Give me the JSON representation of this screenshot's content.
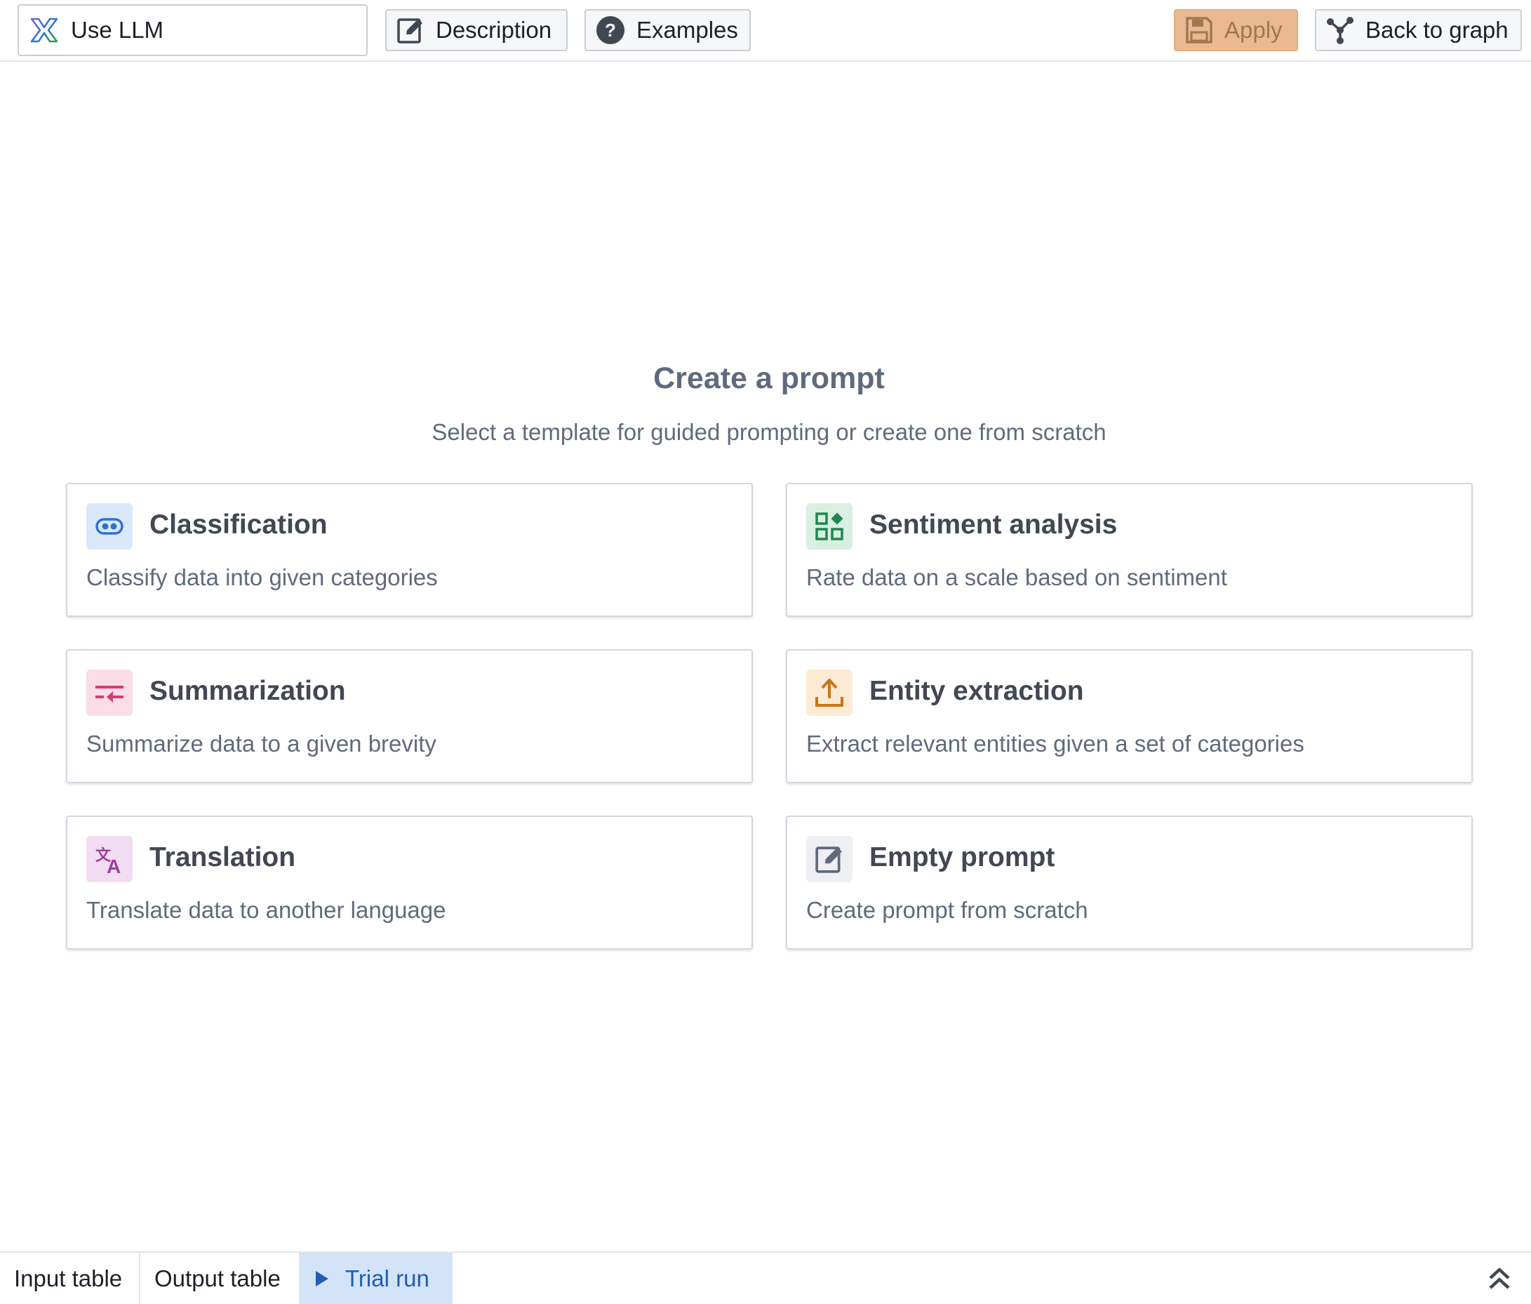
{
  "toolbar": {
    "name_field_value": "Use LLM",
    "description_label": "Description",
    "examples_label": "Examples",
    "apply_label": "Apply",
    "back_label": "Back to graph"
  },
  "main": {
    "heading": "Create a prompt",
    "subheading": "Select a template for guided prompting or create one from scratch",
    "templates": [
      {
        "title": "Classification",
        "description": "Classify data into given categories",
        "icon": "classification-icon",
        "accent": "#2d72d2"
      },
      {
        "title": "Sentiment analysis",
        "description": "Rate data on a scale based on sentiment",
        "icon": "sentiment-grid-icon",
        "accent": "#238551"
      },
      {
        "title": "Summarization",
        "description": "Summarize data to a given brevity",
        "icon": "summarize-icon",
        "accent": "#d33d72"
      },
      {
        "title": "Entity extraction",
        "description": "Extract relevant entities given a set of categories",
        "icon": "upload-icon",
        "accent": "#c87619"
      },
      {
        "title": "Translation",
        "description": "Translate data to another language",
        "icon": "translate-icon",
        "accent": "#9d3f9d"
      },
      {
        "title": "Empty prompt",
        "description": "Create prompt from scratch",
        "icon": "edit-icon",
        "accent": "#5f6b7c"
      }
    ]
  },
  "bottom_tabs": {
    "input_label": "Input table",
    "output_label": "Output table",
    "trial_label": "Trial run"
  },
  "colors": {
    "apply_bg": "#eab98f",
    "active_tab_bg": "#d3e4f8",
    "active_tab_text": "#215db0",
    "heading_text": "#5f6b7c"
  }
}
